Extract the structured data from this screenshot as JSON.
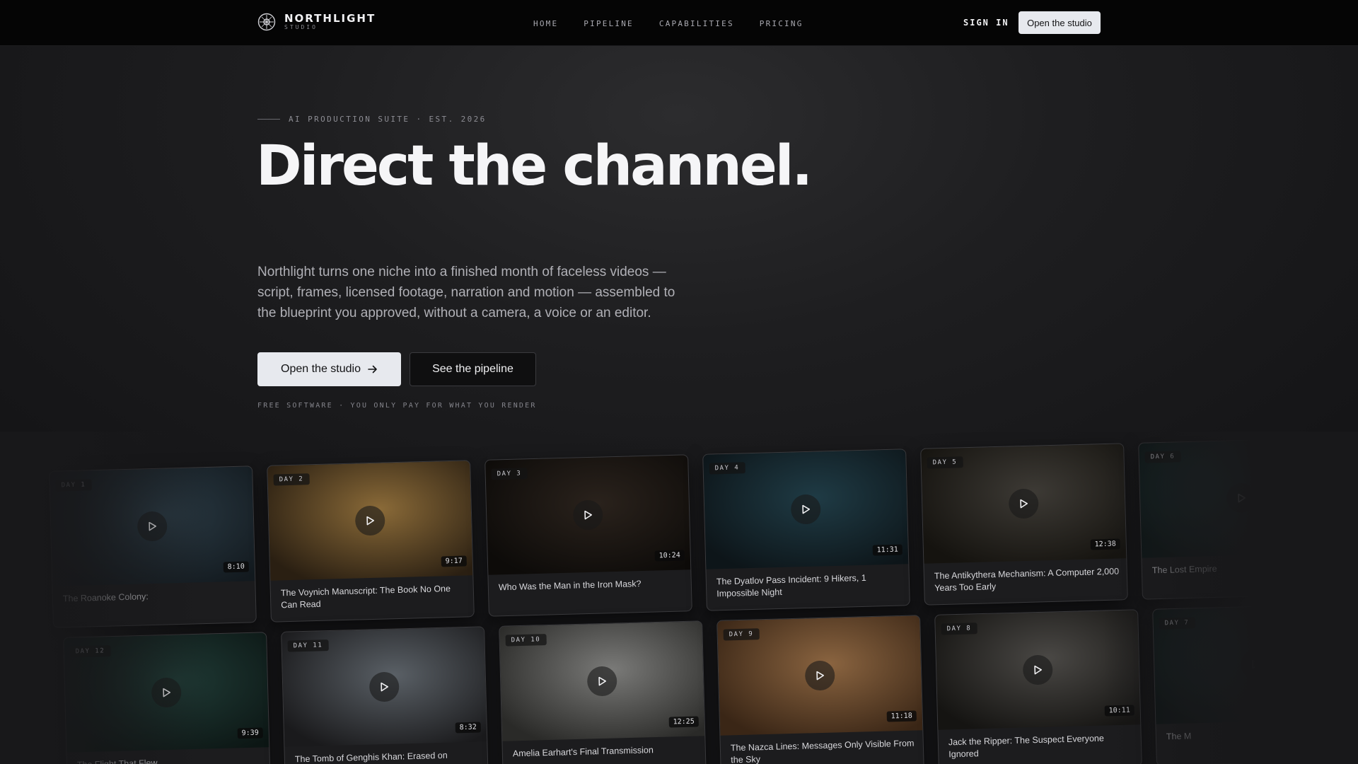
{
  "nav": {
    "brand_name": "NORTHLIGHT",
    "brand_sub": "STUDIO",
    "links": [
      "HOME",
      "PIPELINE",
      "CAPABILITIES",
      "PRICING"
    ],
    "sign_in": "SIGN IN",
    "cta": "Open the studio"
  },
  "hero": {
    "eyebrow": "AI PRODUCTION SUITE · EST. 2026",
    "headline": "Direct the channel.",
    "lede": "Northlight turns one niche into a finished month of faceless videos — script, frames, licensed footage, narration and motion — assembled to the blueprint you approved, without a camera, a voice or an editor.",
    "primary_cta": "Open the studio",
    "secondary_cta": "See the pipeline",
    "fineprint": "FREE SOFTWARE · YOU ONLY PAY FOR WHAT YOU RENDER"
  },
  "gallery": {
    "row1": [
      {
        "day": "DAY 1",
        "duration": "8:10",
        "title": "The Roanoke Colony:",
        "icon": "house-icon",
        "tint": [
          "#2a3a44",
          "#131a1f"
        ]
      },
      {
        "day": "DAY 2",
        "duration": "9:17",
        "title": "The Voynich Manuscript: The Book No One Can Read",
        "icon": "manuscript-icon",
        "tint": [
          "#8a6a38",
          "#2a1f12"
        ]
      },
      {
        "day": "DAY 3",
        "duration": "10:24",
        "title": "Who Was the Man in the Iron Mask?",
        "icon": "mask-icon",
        "tint": [
          "#2a221c",
          "#0d0b09"
        ]
      },
      {
        "day": "DAY 4",
        "duration": "11:31",
        "title": "The Dyatlov Pass Incident: 9 Hikers, 1 Impossible Night",
        "icon": "tent-icon",
        "tint": [
          "#1f3b45",
          "#0d1519"
        ]
      },
      {
        "day": "DAY 5",
        "duration": "12:38",
        "title": "The Antikythera Mechanism: A Computer 2,000 Years Too Early",
        "icon": "gear-icon",
        "tint": [
          "#3d3a35",
          "#15130f"
        ]
      },
      {
        "day": "DAY 6",
        "duration": "",
        "title": "The Lost Empire",
        "icon": "ruins-icon",
        "tint": [
          "#1f3a3a",
          "#0c1616"
        ]
      }
    ],
    "row2": [
      {
        "day": "DAY 12",
        "duration": "9:39",
        "title": "The Flight That Flew",
        "icon": "sea-icon",
        "tint": [
          "#1f3a35",
          "#0c1614"
        ]
      },
      {
        "day": "DAY 11",
        "duration": "8:32",
        "title": "The Tomb of Genghis Khan: Erased on Purpose",
        "icon": "steppe-icon",
        "tint": [
          "#5a6066",
          "#1a1a1c"
        ]
      },
      {
        "day": "DAY 10",
        "duration": "12:25",
        "title": "Amelia Earhart's Final Transmission",
        "icon": "plane-icon",
        "tint": [
          "#7a7a78",
          "#2a2a28"
        ]
      },
      {
        "day": "DAY 9",
        "duration": "11:18",
        "title": "The Nazca Lines: Messages Only Visible From the Sky",
        "icon": "desert-icon",
        "tint": [
          "#8a6440",
          "#3a2616"
        ]
      },
      {
        "day": "DAY 8",
        "duration": "10:11",
        "title": "Jack the Ripper: The Suspect Everyone Ignored",
        "icon": "street-icon",
        "tint": [
          "#4a4845",
          "#151412"
        ]
      },
      {
        "day": "DAY 7",
        "duration": "",
        "title": "The M",
        "icon": "fog-icon",
        "tint": [
          "#1f3535",
          "#0c1414"
        ]
      }
    ]
  }
}
